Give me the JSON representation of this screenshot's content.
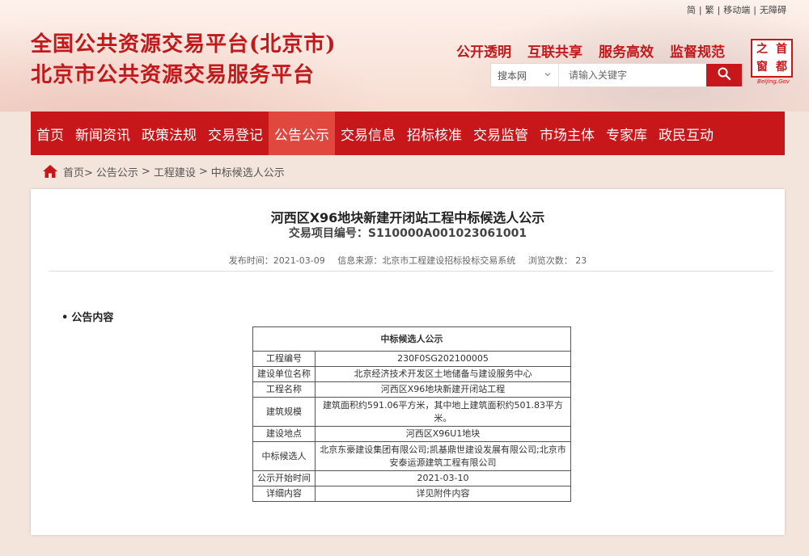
{
  "header": {
    "top_links": [
      "简",
      "|",
      "繁",
      "|",
      "移动端",
      "|",
      "无障碍"
    ],
    "title_line1": "全国公共资源交易平台(北京市)",
    "title_line2": "北京市公共资源交易服务平台",
    "slogans": [
      "公开透明",
      "互联共享",
      "服务高效",
      "监督规范"
    ],
    "search": {
      "scope": "搜本网",
      "placeholder": "请输入关键字"
    },
    "logo": {
      "chars": [
        "首",
        "都",
        "之",
        "窗"
      ],
      "caption": "Beijing.Gov"
    }
  },
  "nav": {
    "items": [
      "首页",
      "新闻资讯",
      "政策法规",
      "交易登记",
      "公告公示",
      "交易信息",
      "招标核准",
      "交易监管",
      "市场主体",
      "专家库",
      "政民互动"
    ],
    "active_index": 4
  },
  "breadcrumb": [
    "首页>",
    "公告公示",
    ">",
    "工程建设",
    ">",
    "中标候选人公示"
  ],
  "article": {
    "title": "河西区X96地块新建开闭站工程中标候选人公示",
    "project_code": "交易项目编号：S110000A001023061001",
    "publish_time": "发布时间：2021-03-09",
    "source": "信息来源：北京市工程建设招标投标交易系统",
    "views": "浏览次数：  23",
    "section_label": "公告内容",
    "table": {
      "header": "中标候选人公示",
      "rows": [
        {
          "label": "工程编号",
          "value": "230F0SG202100005"
        },
        {
          "label": "建设单位名称",
          "value": "北京经济技术开发区土地储备与建设服务中心"
        },
        {
          "label": "工程名称",
          "value": "河西区X96地块新建开闭站工程"
        },
        {
          "label": "建筑规模",
          "value": "建筑面积约591.06平方米，其中地上建筑面积约501.83平方米。"
        },
        {
          "label": "建设地点",
          "value": "河西区X96U1地块"
        },
        {
          "label": "中标候选人",
          "value": "北京东豪建设集团有限公司;凯基鼎世建设发展有限公司;北京市安泰运源建筑工程有限公司"
        },
        {
          "label": "公示开始时间",
          "value": "2021-03-10"
        },
        {
          "label": "详细内容",
          "value": "详见附件内容"
        }
      ]
    }
  },
  "colors": {
    "brand_red": "#c8171b",
    "nav_active": "#e0473f",
    "page_bg": "#f3e4dc"
  },
  "icons": {
    "search": "search-icon",
    "home": "home-icon",
    "dropdown": "chevron-down-icon"
  }
}
